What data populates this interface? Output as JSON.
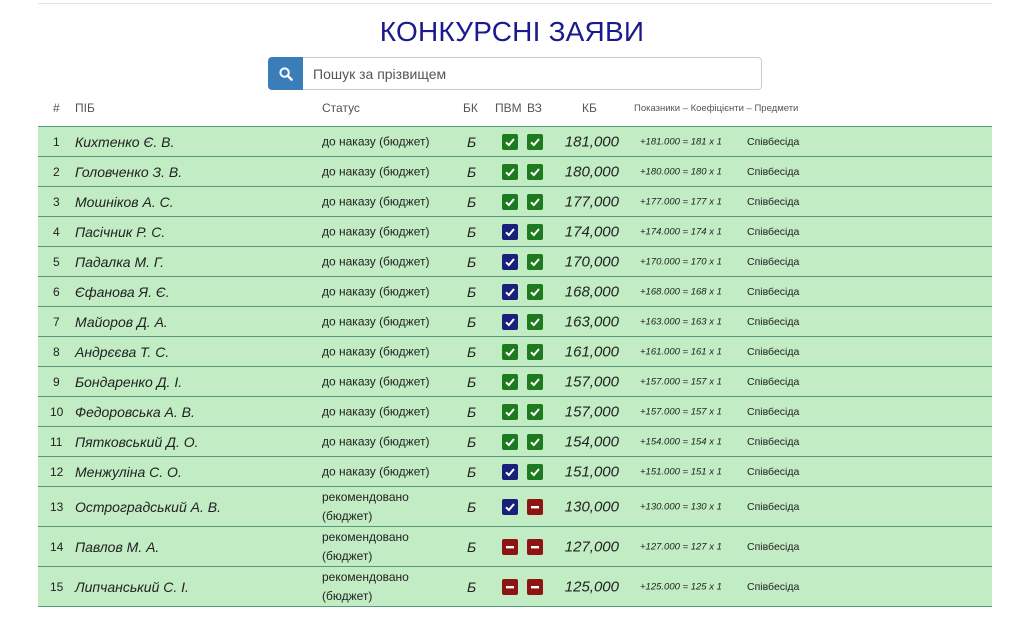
{
  "title": "КОНКУРСНІ ЗАЯВИ",
  "search": {
    "placeholder": "Пошук за прізвищем"
  },
  "columns": {
    "num": "#",
    "name": "ПІБ",
    "status": "Статус",
    "bk": "БК",
    "pvm": "ПВМ",
    "vz": "ВЗ",
    "kb": "КБ",
    "indicators": "Показники – Коефіцієнти – Предмети"
  },
  "icon_names": {
    "checked": "check-icon",
    "rejected": "minus-icon",
    "search": "search-icon"
  },
  "colors": {
    "title": "#1a1a8c",
    "row_bg": "#c2ecc4",
    "check_navy": "#18207a",
    "check_green": "#1e7a1e",
    "minus_red": "#8e1414",
    "search_button": "#3a7db8"
  },
  "rows": [
    {
      "num": "1",
      "name": "Кихтенко Є. В.",
      "status": "до наказу (бюджет)",
      "bk": "Б",
      "pvm": "check-green",
      "vz": "check-green",
      "kb": "181,000",
      "indicators": "+181.000 = 181 x 1",
      "subject": "Співбесіда"
    },
    {
      "num": "2",
      "name": "Головченко З. В.",
      "status": "до наказу (бюджет)",
      "bk": "Б",
      "pvm": "check-green",
      "vz": "check-green",
      "kb": "180,000",
      "indicators": "+180.000 = 180 x 1",
      "subject": "Співбесіда"
    },
    {
      "num": "3",
      "name": "Мошніков А. С.",
      "status": "до наказу (бюджет)",
      "bk": "Б",
      "pvm": "check-green",
      "vz": "check-green",
      "kb": "177,000",
      "indicators": "+177.000 = 177 x 1",
      "subject": "Співбесіда"
    },
    {
      "num": "4",
      "name": "Пасічник Р. С.",
      "status": "до наказу (бюджет)",
      "bk": "Б",
      "pvm": "check-navy",
      "vz": "check-green",
      "kb": "174,000",
      "indicators": "+174.000 = 174 x 1",
      "subject": "Співбесіда"
    },
    {
      "num": "5",
      "name": "Падалка М. Г.",
      "status": "до наказу (бюджет)",
      "bk": "Б",
      "pvm": "check-navy",
      "vz": "check-green",
      "kb": "170,000",
      "indicators": "+170.000 = 170 x 1",
      "subject": "Співбесіда"
    },
    {
      "num": "6",
      "name": "Єфанова Я. Є.",
      "status": "до наказу (бюджет)",
      "bk": "Б",
      "pvm": "check-navy",
      "vz": "check-green",
      "kb": "168,000",
      "indicators": "+168.000 = 168 x 1",
      "subject": "Співбесіда"
    },
    {
      "num": "7",
      "name": "Майоров Д. А.",
      "status": "до наказу (бюджет)",
      "bk": "Б",
      "pvm": "check-navy",
      "vz": "check-green",
      "kb": "163,000",
      "indicators": "+163.000 = 163 x 1",
      "subject": "Співбесіда"
    },
    {
      "num": "8",
      "name": "Андрєєва Т. С.",
      "status": "до наказу (бюджет)",
      "bk": "Б",
      "pvm": "check-green",
      "vz": "check-green",
      "kb": "161,000",
      "indicators": "+161.000 = 161 x 1",
      "subject": "Співбесіда"
    },
    {
      "num": "9",
      "name": "Бондаренко Д. І.",
      "status": "до наказу (бюджет)",
      "bk": "Б",
      "pvm": "check-green",
      "vz": "check-green",
      "kb": "157,000",
      "indicators": "+157.000 = 157 x 1",
      "subject": "Співбесіда"
    },
    {
      "num": "10",
      "name": "Федоровська А. В.",
      "status": "до наказу (бюджет)",
      "bk": "Б",
      "pvm": "check-green",
      "vz": "check-green",
      "kb": "157,000",
      "indicators": "+157.000 = 157 x 1",
      "subject": "Співбесіда"
    },
    {
      "num": "11",
      "name": "Пятковський Д. О.",
      "status": "до наказу (бюджет)",
      "bk": "Б",
      "pvm": "check-green",
      "vz": "check-green",
      "kb": "154,000",
      "indicators": "+154.000 = 154 x 1",
      "subject": "Співбесіда"
    },
    {
      "num": "12",
      "name": "Менжуліна С. О.",
      "status": "до наказу (бюджет)",
      "bk": "Б",
      "pvm": "check-navy",
      "vz": "check-green",
      "kb": "151,000",
      "indicators": "+151.000 = 151 x 1",
      "subject": "Співбесіда"
    },
    {
      "num": "13",
      "name": "Остроградський А. В.",
      "status": "рекомендовано (бюджет)",
      "bk": "Б",
      "pvm": "check-navy",
      "vz": "minus-red",
      "kb": "130,000",
      "indicators": "+130.000 = 130 x 1",
      "subject": "Співбесіда"
    },
    {
      "num": "14",
      "name": "Павлов М. А.",
      "status": "рекомендовано (бюджет)",
      "bk": "Б",
      "pvm": "minus-red",
      "vz": "minus-red",
      "kb": "127,000",
      "indicators": "+127.000 = 127 x 1",
      "subject": "Співбесіда"
    },
    {
      "num": "15",
      "name": "Липчанський С. І.",
      "status": "рекомендовано (бюджет)",
      "bk": "Б",
      "pvm": "minus-red",
      "vz": "minus-red",
      "kb": "125,000",
      "indicators": "+125.000 = 125 x 1",
      "subject": "Співбесіда"
    }
  ]
}
